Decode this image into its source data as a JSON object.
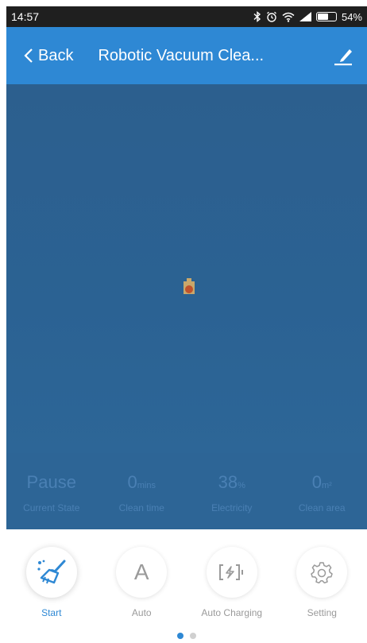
{
  "status_bar": {
    "time": "14:57",
    "battery_percent": "54%",
    "icons": [
      "bluetooth-icon",
      "alarm-icon",
      "wifi-icon",
      "signal-icon",
      "battery-icon"
    ]
  },
  "nav": {
    "back_label": "Back",
    "title": "Robotic Vacuum Clea...",
    "edit_icon": "edit-pencil-icon"
  },
  "map": {
    "background_color": "#2c5f8e",
    "robot_icon": "robot-marker-icon"
  },
  "stats": [
    {
      "value": "Pause",
      "unit": "",
      "label": "Current State"
    },
    {
      "value": "0",
      "unit": "mins",
      "label": "Clean time"
    },
    {
      "value": "38",
      "unit": "%",
      "label": "Electricity"
    },
    {
      "value": "0",
      "unit": "m²",
      "label": "Clean area"
    }
  ],
  "actions": [
    {
      "label": "Start",
      "icon": "broom-icon",
      "active": true
    },
    {
      "label": "Auto",
      "icon": "auto-letter-icon",
      "glyph": "A",
      "active": false
    },
    {
      "label": "Auto Charging",
      "icon": "charging-icon",
      "active": false
    },
    {
      "label": "Setting",
      "icon": "gear-icon",
      "active": false
    }
  ],
  "pager": {
    "pages": 2,
    "current": 1
  },
  "colors": {
    "accent": "#2e88d4",
    "status_bar": "#1f1f1f",
    "stat_text": "#4a80b4"
  }
}
